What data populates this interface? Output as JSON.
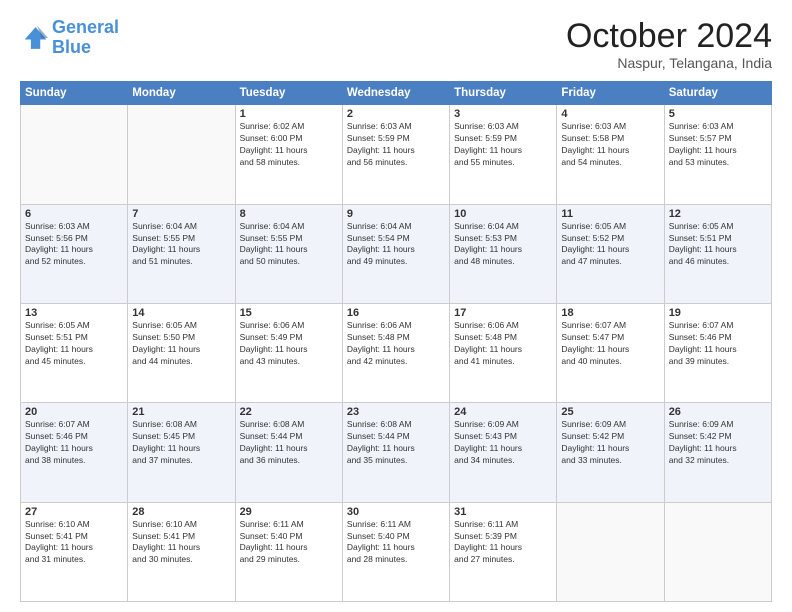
{
  "logo": {
    "line1": "General",
    "line2": "Blue"
  },
  "title": "October 2024",
  "subtitle": "Naspur, Telangana, India",
  "days_of_week": [
    "Sunday",
    "Monday",
    "Tuesday",
    "Wednesday",
    "Thursday",
    "Friday",
    "Saturday"
  ],
  "weeks": [
    [
      {
        "day": "",
        "detail": ""
      },
      {
        "day": "",
        "detail": ""
      },
      {
        "day": "1",
        "detail": "Sunrise: 6:02 AM\nSunset: 6:00 PM\nDaylight: 11 hours\nand 58 minutes."
      },
      {
        "day": "2",
        "detail": "Sunrise: 6:03 AM\nSunset: 5:59 PM\nDaylight: 11 hours\nand 56 minutes."
      },
      {
        "day": "3",
        "detail": "Sunrise: 6:03 AM\nSunset: 5:59 PM\nDaylight: 11 hours\nand 55 minutes."
      },
      {
        "day": "4",
        "detail": "Sunrise: 6:03 AM\nSunset: 5:58 PM\nDaylight: 11 hours\nand 54 minutes."
      },
      {
        "day": "5",
        "detail": "Sunrise: 6:03 AM\nSunset: 5:57 PM\nDaylight: 11 hours\nand 53 minutes."
      }
    ],
    [
      {
        "day": "6",
        "detail": "Sunrise: 6:03 AM\nSunset: 5:56 PM\nDaylight: 11 hours\nand 52 minutes."
      },
      {
        "day": "7",
        "detail": "Sunrise: 6:04 AM\nSunset: 5:55 PM\nDaylight: 11 hours\nand 51 minutes."
      },
      {
        "day": "8",
        "detail": "Sunrise: 6:04 AM\nSunset: 5:55 PM\nDaylight: 11 hours\nand 50 minutes."
      },
      {
        "day": "9",
        "detail": "Sunrise: 6:04 AM\nSunset: 5:54 PM\nDaylight: 11 hours\nand 49 minutes."
      },
      {
        "day": "10",
        "detail": "Sunrise: 6:04 AM\nSunset: 5:53 PM\nDaylight: 11 hours\nand 48 minutes."
      },
      {
        "day": "11",
        "detail": "Sunrise: 6:05 AM\nSunset: 5:52 PM\nDaylight: 11 hours\nand 47 minutes."
      },
      {
        "day": "12",
        "detail": "Sunrise: 6:05 AM\nSunset: 5:51 PM\nDaylight: 11 hours\nand 46 minutes."
      }
    ],
    [
      {
        "day": "13",
        "detail": "Sunrise: 6:05 AM\nSunset: 5:51 PM\nDaylight: 11 hours\nand 45 minutes."
      },
      {
        "day": "14",
        "detail": "Sunrise: 6:05 AM\nSunset: 5:50 PM\nDaylight: 11 hours\nand 44 minutes."
      },
      {
        "day": "15",
        "detail": "Sunrise: 6:06 AM\nSunset: 5:49 PM\nDaylight: 11 hours\nand 43 minutes."
      },
      {
        "day": "16",
        "detail": "Sunrise: 6:06 AM\nSunset: 5:48 PM\nDaylight: 11 hours\nand 42 minutes."
      },
      {
        "day": "17",
        "detail": "Sunrise: 6:06 AM\nSunset: 5:48 PM\nDaylight: 11 hours\nand 41 minutes."
      },
      {
        "day": "18",
        "detail": "Sunrise: 6:07 AM\nSunset: 5:47 PM\nDaylight: 11 hours\nand 40 minutes."
      },
      {
        "day": "19",
        "detail": "Sunrise: 6:07 AM\nSunset: 5:46 PM\nDaylight: 11 hours\nand 39 minutes."
      }
    ],
    [
      {
        "day": "20",
        "detail": "Sunrise: 6:07 AM\nSunset: 5:46 PM\nDaylight: 11 hours\nand 38 minutes."
      },
      {
        "day": "21",
        "detail": "Sunrise: 6:08 AM\nSunset: 5:45 PM\nDaylight: 11 hours\nand 37 minutes."
      },
      {
        "day": "22",
        "detail": "Sunrise: 6:08 AM\nSunset: 5:44 PM\nDaylight: 11 hours\nand 36 minutes."
      },
      {
        "day": "23",
        "detail": "Sunrise: 6:08 AM\nSunset: 5:44 PM\nDaylight: 11 hours\nand 35 minutes."
      },
      {
        "day": "24",
        "detail": "Sunrise: 6:09 AM\nSunset: 5:43 PM\nDaylight: 11 hours\nand 34 minutes."
      },
      {
        "day": "25",
        "detail": "Sunrise: 6:09 AM\nSunset: 5:42 PM\nDaylight: 11 hours\nand 33 minutes."
      },
      {
        "day": "26",
        "detail": "Sunrise: 6:09 AM\nSunset: 5:42 PM\nDaylight: 11 hours\nand 32 minutes."
      }
    ],
    [
      {
        "day": "27",
        "detail": "Sunrise: 6:10 AM\nSunset: 5:41 PM\nDaylight: 11 hours\nand 31 minutes."
      },
      {
        "day": "28",
        "detail": "Sunrise: 6:10 AM\nSunset: 5:41 PM\nDaylight: 11 hours\nand 30 minutes."
      },
      {
        "day": "29",
        "detail": "Sunrise: 6:11 AM\nSunset: 5:40 PM\nDaylight: 11 hours\nand 29 minutes."
      },
      {
        "day": "30",
        "detail": "Sunrise: 6:11 AM\nSunset: 5:40 PM\nDaylight: 11 hours\nand 28 minutes."
      },
      {
        "day": "31",
        "detail": "Sunrise: 6:11 AM\nSunset: 5:39 PM\nDaylight: 11 hours\nand 27 minutes."
      },
      {
        "day": "",
        "detail": ""
      },
      {
        "day": "",
        "detail": ""
      }
    ]
  ]
}
